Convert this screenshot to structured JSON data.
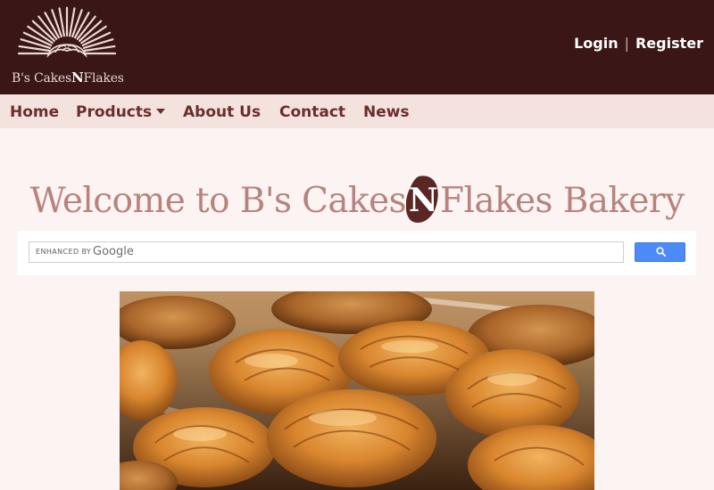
{
  "header": {
    "logo": {
      "name_part1": "B's Cakes",
      "name_n": "N",
      "name_part2": "Flakes"
    },
    "login_label": "Login",
    "separator": "|",
    "register_label": "Register"
  },
  "nav": {
    "items": [
      {
        "label": "Home"
      },
      {
        "label": "Products"
      },
      {
        "label": "About Us"
      },
      {
        "label": "Contact"
      },
      {
        "label": "News"
      }
    ]
  },
  "main": {
    "welcome_prefix": "Welcome to B's Cakes",
    "welcome_n": "N",
    "welcome_suffix": "Flakes Bakery"
  },
  "search": {
    "enhanced_by": "ENHANCED BY",
    "provider": "Google",
    "button_icon": "search-icon"
  },
  "hero": {
    "image": "croissants-photo"
  },
  "colors": {
    "header_bg": "#3b1616",
    "nav_bg": "#f4e2df",
    "nav_text": "#6b2e2a",
    "title_text": "#b8837f",
    "search_button": "#4c8bf5"
  }
}
